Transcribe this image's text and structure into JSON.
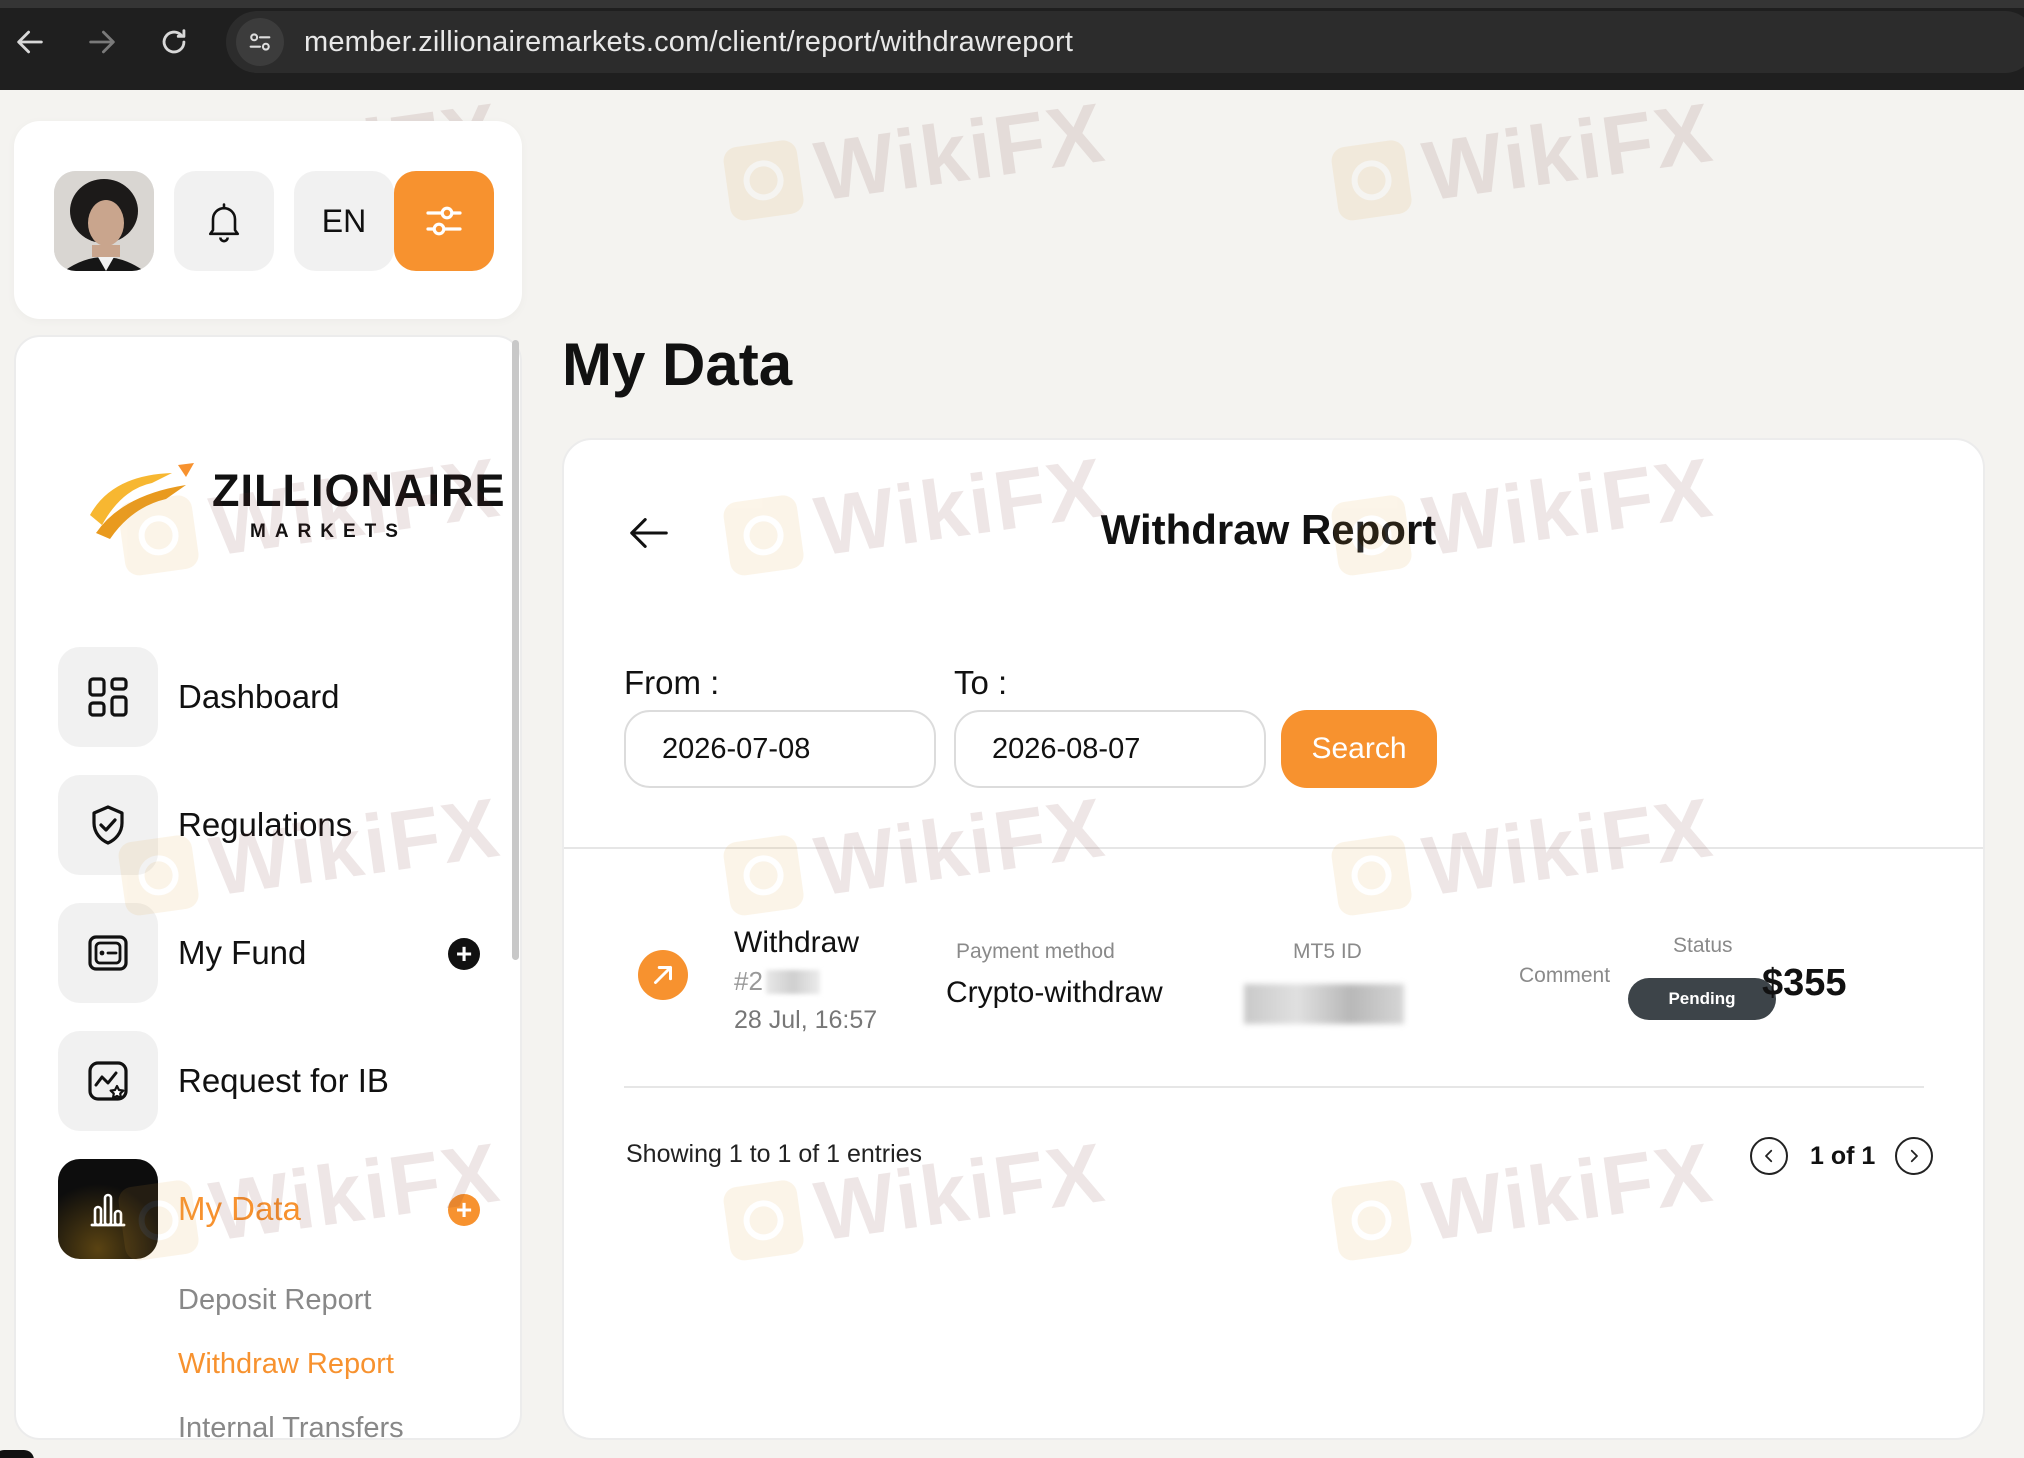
{
  "browser": {
    "url": "member.zillionairemarkets.com/client/report/withdrawreport"
  },
  "header": {
    "language": "EN"
  },
  "brand": {
    "name": "ZILLIONAIRE",
    "subtitle": "MARKETS"
  },
  "sidebar": {
    "items": [
      {
        "label": "Dashboard",
        "icon": "grid-icon"
      },
      {
        "label": "Regulations",
        "icon": "shield-check-icon"
      },
      {
        "label": "My Fund",
        "icon": "wallet-icon",
        "expand": "+"
      },
      {
        "label": "Request for IB",
        "icon": "chart-star-icon"
      },
      {
        "label": "My Data",
        "icon": "bar-chart-icon",
        "expand": "+",
        "active": true
      }
    ],
    "sub_items": [
      {
        "label": "Deposit Report",
        "active": false
      },
      {
        "label": "Withdraw Report",
        "active": true
      },
      {
        "label": "Internal Transfers",
        "active": false
      }
    ]
  },
  "main": {
    "page_title": "My Data",
    "card_title": "Withdraw Report",
    "filters": {
      "from_label": "From :",
      "from_value": "2026-07-08",
      "to_label": "To :",
      "to_value": "2026-08-07",
      "search_label": "Search"
    },
    "rows": [
      {
        "type": "Withdraw",
        "tx_id": "#2",
        "datetime": "28 Jul, 16:57",
        "payment_method_label": "Payment method",
        "payment_method": "Crypto-withdraw",
        "mt5_label": "MT5 ID",
        "comment_label": "Comment",
        "status_label": "Status",
        "status": "Pending",
        "amount": "$355"
      }
    ],
    "showing": "Showing 1 to 1 of 1 entries",
    "pagination": "1 of 1"
  },
  "watermark": "WikiFX",
  "colors": {
    "accent": "#f7922f",
    "badge": "#3d4449",
    "chrome": "#1f1f1f"
  }
}
